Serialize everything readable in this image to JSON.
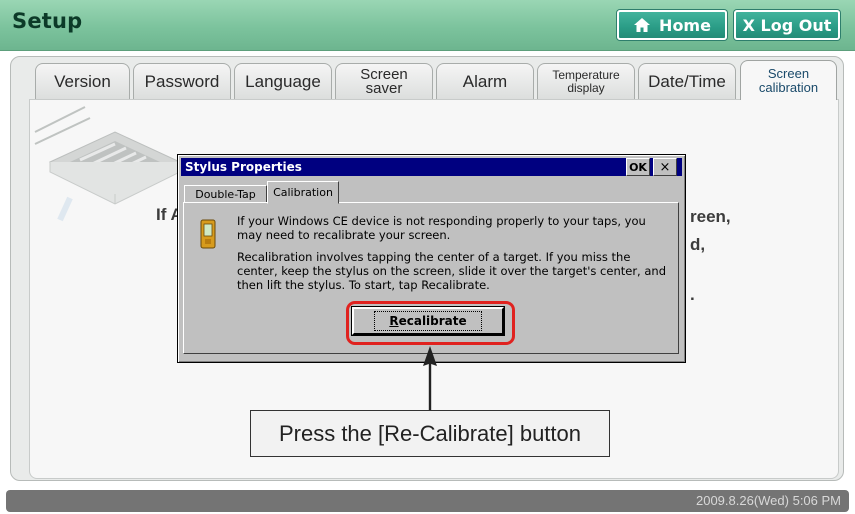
{
  "header": {
    "title": "Setup",
    "home_label": "Home",
    "logout_label": "X Log Out",
    "colors": {
      "header_green": "#7cc39d",
      "button_teal": "#2a9c86"
    }
  },
  "tabs": [
    {
      "line1": "Version",
      "line2": ""
    },
    {
      "line1": "Password",
      "line2": ""
    },
    {
      "line1": "Language",
      "line2": ""
    },
    {
      "line1": "Screen",
      "line2": "saver"
    },
    {
      "line1": "Alarm",
      "line2": ""
    },
    {
      "line1": "Temperature",
      "line2": "display"
    },
    {
      "line1": "Date/Time",
      "line2": ""
    },
    {
      "line1": "Screen",
      "line2": "calibration",
      "active": true
    }
  ],
  "background_text": {
    "left": "If A",
    "right1": "reen,",
    "right2": "d,",
    "right3": "."
  },
  "dialog": {
    "title": "Stylus Properties",
    "ok_label": "OK",
    "close_label": "×",
    "tabs": [
      "Double-Tap",
      "Calibration"
    ],
    "active_tab": "Calibration",
    "paragraph1": "If your Windows CE device is not responding properly to your taps, you may need to recalibrate your screen.",
    "paragraph2": "Recalibration involves tapping the center of a target. If you miss the center, keep the stylus on the screen, slide it over the target's center, and then lift the stylus. To start, tap Recalibrate.",
    "button_accel": "R",
    "button_rest": "ecalibrate"
  },
  "callout": {
    "text": "Press the [Re-Calibrate] button",
    "highlight_color": "#e0221f"
  },
  "status": {
    "datetime": "2009.8.26(Wed)  5:06 PM"
  }
}
